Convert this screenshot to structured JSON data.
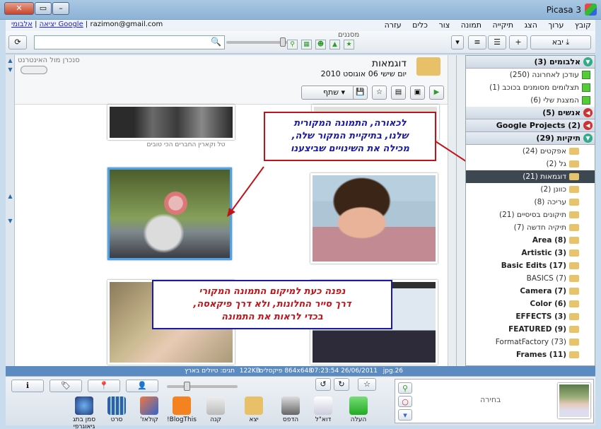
{
  "window": {
    "title": "Picasa 3"
  },
  "menu": [
    "קובץ",
    "ערוך",
    "הצג",
    "תיקייה",
    "תמונה",
    "צור",
    "כלים",
    "עזרה"
  ],
  "account": {
    "email": "razimon@gmail.com",
    "albums_link": "אלבומי Google",
    "exit_link": "יציאה",
    "sep": "|"
  },
  "toolbar": {
    "import_label": "יבא",
    "filters_label": "מסננים"
  },
  "panel": {
    "albums": {
      "label": "אלבומים (3)",
      "items": [
        "עודכן לאחרונה (250)",
        "תצלומים מסומנים בכוכב (1)",
        "המצגת שלי (6)"
      ]
    },
    "people": {
      "label": "אנשים (5)"
    },
    "google": {
      "label": "Google Projects (2)"
    },
    "folders": {
      "label": "תיקיות (29)",
      "items": [
        {
          "label": "אפקטים (24)",
          "style": "normal"
        },
        {
          "label": "גל (2)",
          "style": "normal"
        },
        {
          "label": "דוגמאות (21)",
          "style": "selected"
        },
        {
          "label": "כוונן (2)",
          "style": "normal"
        },
        {
          "label": "עריכה (8)",
          "style": "normal"
        },
        {
          "label": "תיקונים בסיסיים (21)",
          "style": "normal"
        },
        {
          "label": "תיקיה חדשה (7)",
          "style": "normal"
        },
        {
          "label": "Area (8)",
          "style": "bold"
        },
        {
          "label": "Artistic (3)",
          "style": "bold"
        },
        {
          "label": "Basic Edits (17)",
          "style": "bold"
        },
        {
          "label": "BASICS (7)",
          "style": "normal"
        },
        {
          "label": "Camera (7)",
          "style": "bold"
        },
        {
          "label": "Color (6)",
          "style": "bold"
        },
        {
          "label": "EFFECTS (3)",
          "style": "bold"
        },
        {
          "label": "FEATURED (9)",
          "style": "bold"
        },
        {
          "label": "FormatFactory (73)",
          "style": "normal"
        },
        {
          "label": "Frames (11)",
          "style": "bold"
        }
      ]
    }
  },
  "main": {
    "album_title": "דוגמאות",
    "album_date": "יום שישי 06 אוגוסט 2010",
    "sync_label": "סנכרן מול האינטרנט",
    "share_label": "שתף",
    "caption": "טל וקארין החברים הכי טובים"
  },
  "callouts": {
    "top": [
      "לכאורה, התמונה המקורית",
      "שלנו, בתיקיית המקור שלה,",
      "מכילה את השינויים שביצענו"
    ],
    "bottom": [
      "נפנה כעת למיקום התמונה המקורי",
      "דרך סייר החלונות, ולא דרך פיקאסה,",
      "בכדי לראות את התמונה"
    ]
  },
  "status": {
    "filename": "26.jpg",
    "datetime": "26/06/2011 07:23:54",
    "dimensions": "864x648 פיקסלים",
    "size": "122KB",
    "tags": "תגים: טיולים בארץ"
  },
  "tray": {
    "selection_label": "בחירה",
    "actions": [
      "העלה",
      "דוא\"ל",
      "הדפס",
      "יצא",
      "קנה",
      "BlogThis!",
      "קולאז'",
      "סרט",
      "סמן בתג גיאוגרפי"
    ]
  },
  "colors": {
    "callout_top_border": "#c0141a",
    "callout_bottom_border": "#1a1aa8",
    "callout_text": "#1a1aa8",
    "arrow": "#c0141a",
    "selected_folder": "#3d4752"
  }
}
